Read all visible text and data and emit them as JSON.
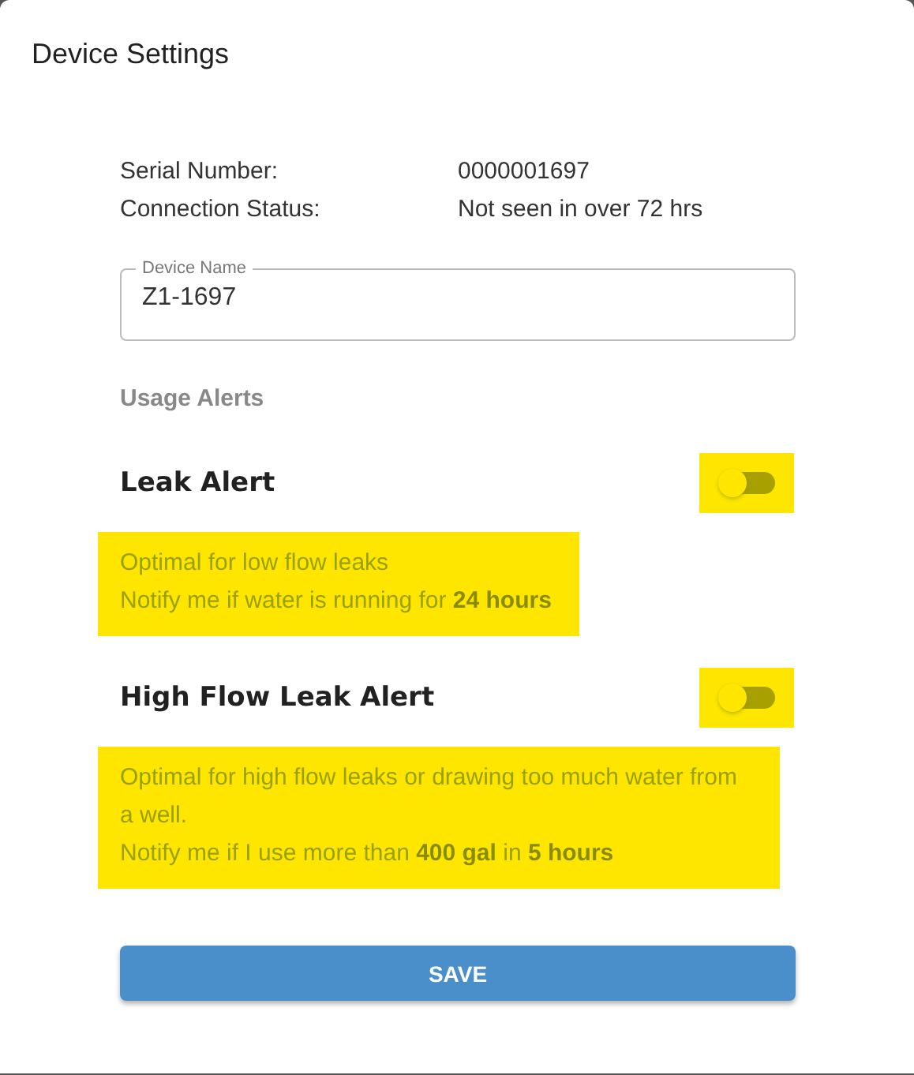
{
  "dialog": {
    "title": "Device Settings"
  },
  "info": [
    {
      "label": "Serial Number:",
      "value": "0000001697"
    },
    {
      "label": "Connection Status:",
      "value": "Not seen in over 72 hrs"
    }
  ],
  "device_name": {
    "label": "Device Name",
    "value": "Z1-1697"
  },
  "section_title": "Usage Alerts",
  "alerts": [
    {
      "title": "Leak Alert",
      "on": false,
      "highlighted": true,
      "lines": [
        "Optimal for low flow leaks",
        "Notify me if water is running for **24 hours**"
      ]
    },
    {
      "title": "High Flow Leak Alert",
      "on": false,
      "highlighted": true,
      "lines": [
        "Optimal for high flow leaks or drawing too much water from a well.",
        "Notify me if I use more than **400 gal** in **5 hours**"
      ]
    }
  ],
  "save_button": "SAVE"
}
